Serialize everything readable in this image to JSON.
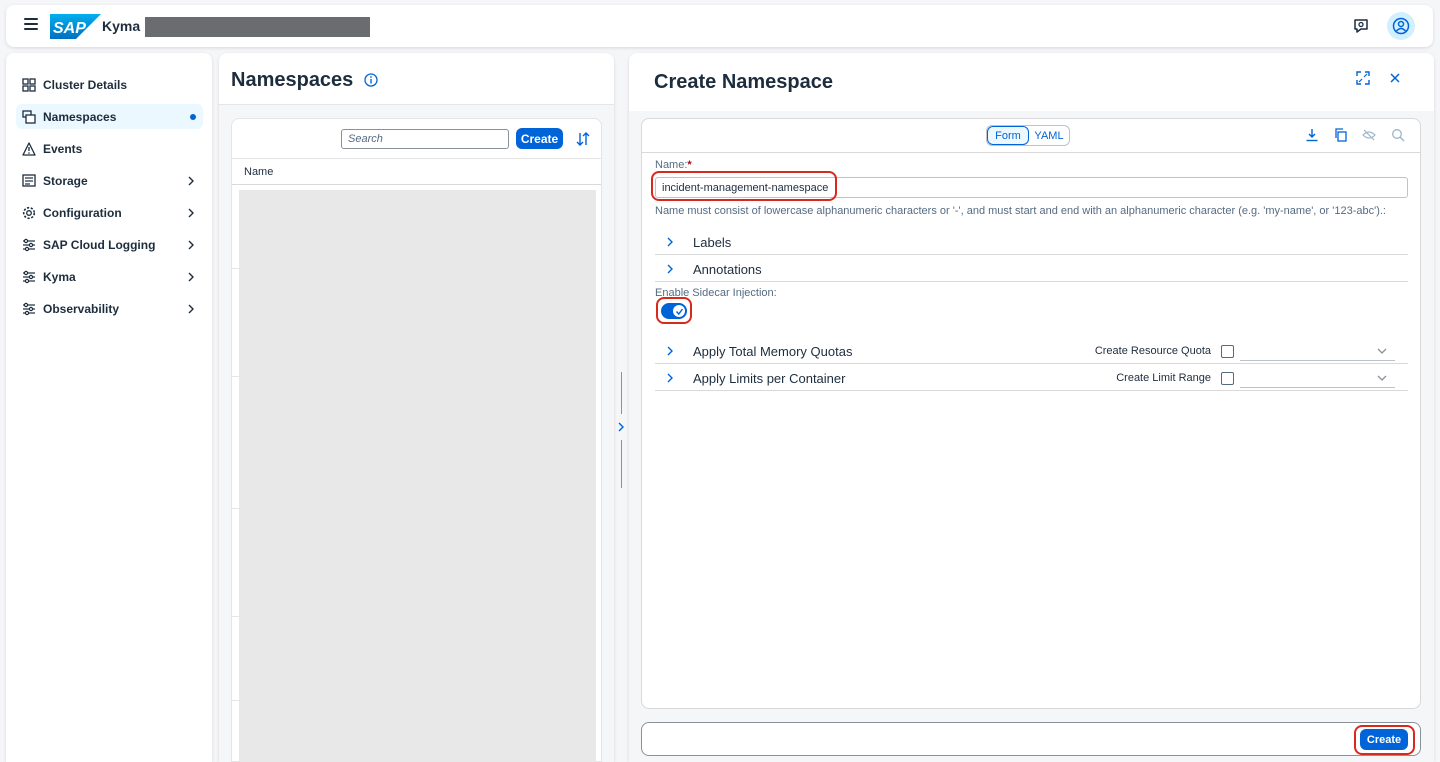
{
  "shellbar": {
    "product_name": "Kyma",
    "logo_text": "SAP",
    "menu_icon": "hamburger-menu-icon",
    "feedback_icon": "feedback-icon",
    "user_icon": "user-avatar-icon"
  },
  "sidebar": {
    "items": [
      {
        "label": "Cluster Details",
        "icon": "cluster-details-icon",
        "has_chevron": false
      },
      {
        "label": "Namespaces",
        "icon": "namespaces-icon",
        "selected": true
      },
      {
        "label": "Events",
        "icon": "warning-icon",
        "has_chevron": false
      },
      {
        "label": "Storage",
        "icon": "storage-icon",
        "has_chevron": true
      },
      {
        "label": "Configuration",
        "icon": "gear-icon",
        "has_chevron": true
      },
      {
        "label": "SAP Cloud Logging",
        "icon": "sliders-icon",
        "has_chevron": true
      },
      {
        "label": "Kyma",
        "icon": "sliders-icon",
        "has_chevron": true
      },
      {
        "label": "Observability",
        "icon": "sliders-icon",
        "has_chevron": true
      }
    ]
  },
  "namespaces": {
    "title": "Namespaces",
    "search_placeholder": "Search",
    "create_label": "Create",
    "column_name": "Name"
  },
  "create_namespace": {
    "title": "Create Namespace",
    "tabs": {
      "form": "Form",
      "yaml": "YAML",
      "selected": "Form"
    },
    "name_label": "Name:",
    "required_mark": "*",
    "name_value": "incident-management-namespace",
    "name_hint": "Name must consist of lowercase alphanumeric characters or '-', and must start and end with an alphanumeric character (e.g. 'my-name', or '123-abc').:",
    "labels_label": "Labels",
    "annotations_label": "Annotations",
    "sidecar_label": "Enable Sidecar Injection:",
    "sidecar_enabled": true,
    "memory_quotas_label": "Apply Total Memory Quotas",
    "resource_quota_label": "Create Resource Quota",
    "resource_quota_checked": false,
    "limits_label": "Apply Limits per Container",
    "limit_range_label": "Create Limit Range",
    "limit_range_checked": false,
    "footer_create_label": "Create"
  },
  "colors": {
    "accent": "#0064d9",
    "highlight": "#d9281c",
    "text": "#1d2d3e",
    "muted": "#556b82"
  }
}
